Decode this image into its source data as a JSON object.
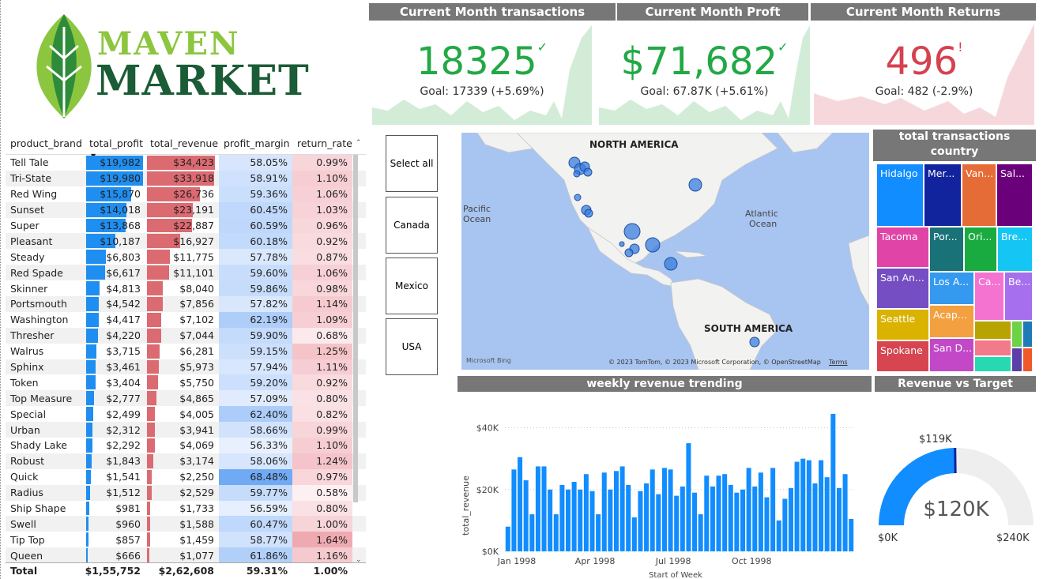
{
  "logo": {
    "line1": "MAVEN",
    "line2": "MARKET"
  },
  "table": {
    "headers": [
      "product_brand",
      "total_profit",
      "total_revenue",
      "profit_margin",
      "return_rate"
    ],
    "rows": [
      [
        "Tell Tale",
        "$19,982",
        "$34,423",
        "58.05%",
        "0.99%"
      ],
      [
        "Tri-State",
        "$19,980",
        "$33,918",
        "58.91%",
        "1.10%"
      ],
      [
        "Red Wing",
        "$15,870",
        "$26,736",
        "59.36%",
        "1.06%"
      ],
      [
        "Sunset",
        "$14,018",
        "$23,191",
        "60.45%",
        "1.03%"
      ],
      [
        "Super",
        "$13,868",
        "$22,887",
        "60.59%",
        "0.96%"
      ],
      [
        "Pleasant",
        "$10,187",
        "$16,927",
        "60.18%",
        "0.92%"
      ],
      [
        "Steady",
        "$6,803",
        "$11,775",
        "57.78%",
        "0.87%"
      ],
      [
        "Red Spade",
        "$6,617",
        "$11,101",
        "59.60%",
        "1.06%"
      ],
      [
        "Skinner",
        "$4,813",
        "$8,040",
        "59.86%",
        "0.98%"
      ],
      [
        "Portsmouth",
        "$4,542",
        "$7,856",
        "57.82%",
        "1.14%"
      ],
      [
        "Washington",
        "$4,417",
        "$7,102",
        "62.19%",
        "1.09%"
      ],
      [
        "Thresher",
        "$4,220",
        "$7,044",
        "59.90%",
        "0.68%"
      ],
      [
        "Walrus",
        "$3,715",
        "$6,281",
        "59.15%",
        "1.25%"
      ],
      [
        "Sphinx",
        "$3,461",
        "$5,973",
        "57.94%",
        "1.11%"
      ],
      [
        "Token",
        "$3,404",
        "$5,750",
        "59.20%",
        "0.92%"
      ],
      [
        "Top Measure",
        "$2,777",
        "$4,865",
        "57.09%",
        "0.80%"
      ],
      [
        "Special",
        "$2,499",
        "$4,005",
        "62.40%",
        "0.82%"
      ],
      [
        "Urban",
        "$2,312",
        "$3,941",
        "58.66%",
        "0.99%"
      ],
      [
        "Shady Lake",
        "$2,292",
        "$4,069",
        "56.33%",
        "1.10%"
      ],
      [
        "Robust",
        "$1,843",
        "$3,174",
        "58.06%",
        "1.24%"
      ],
      [
        "Quick",
        "$1,541",
        "$2,250",
        "68.48%",
        "0.97%"
      ],
      [
        "Radius",
        "$1,512",
        "$2,529",
        "59.77%",
        "0.58%"
      ],
      [
        "Ship Shape",
        "$981",
        "$1,733",
        "56.59%",
        "0.80%"
      ],
      [
        "Swell",
        "$960",
        "$1,588",
        "60.47%",
        "1.00%"
      ],
      [
        "Tip Top",
        "$857",
        "$1,459",
        "58.77%",
        "1.64%"
      ],
      [
        "Queen",
        "$666",
        "$1,077",
        "61.86%",
        "1.16%"
      ]
    ],
    "total": [
      "Total",
      "$1,55,752",
      "$2,62,608",
      "59.31%",
      "1.00%"
    ]
  },
  "kpis": {
    "transactions": {
      "title": "Current Month transactions",
      "value": "18325",
      "mark": "✓",
      "goal": "Goal: 17339 (+5.69%)",
      "color": "#22a845"
    },
    "profit": {
      "title": "Current Month Proft",
      "value": "$71,682",
      "mark": "✓",
      "goal": "Goal: 67.87K (+5.61%)",
      "color": "#22a845"
    },
    "returns": {
      "title": "Current Month Returns",
      "value": "496",
      "mark": "!",
      "goal": "Goal: 482 (-2.9%)",
      "color": "#d6404f"
    }
  },
  "slicer": {
    "items": [
      "Select all",
      "Canada",
      "Mexico",
      "USA"
    ]
  },
  "map": {
    "labels": {
      "north_america": "NORTH AMERICA",
      "south_america": "SOUTH AMERICA",
      "pacific1": "Pacific",
      "pacific2": "Ocean",
      "atlantic1": "Atlantic",
      "atlantic2": "Ocean"
    },
    "bing": "Microsoft Bing",
    "credits": "© 2023 TomTom, © 2023 Microsoft Corporation, © OpenStreetMap",
    "terms": "Terms"
  },
  "treemap": {
    "title": "total transactions country",
    "tiles": [
      "Hidalgo",
      "Mer...",
      "Van...",
      "Sal...",
      "Tacoma",
      "Por...",
      "Ori...",
      "Bre...",
      "San An...",
      "Los A...",
      "Ca...",
      "Be...",
      "Seattle",
      "Acap...",
      "Spokane",
      "San D..."
    ]
  },
  "weekly": {
    "title": "weekly revenue trending",
    "ylabel": "total_revenue",
    "xlabel": "Start of Week",
    "yticks": [
      "$0K",
      "$20K",
      "$40K"
    ],
    "xticks": [
      "Jan 1998",
      "Apr 1998",
      "Jul 1998",
      "Oct 1998"
    ]
  },
  "gauge": {
    "title": "Revenue vs Target",
    "value_label": "$120K",
    "target_label": "$119K",
    "min_label": "$0K",
    "max_label": "$240K",
    "value": 120,
    "target": 119,
    "max": 240
  },
  "chart_data": {
    "type": "bar",
    "title": "weekly revenue trending",
    "xlabel": "Start of Week",
    "ylabel": "total_revenue",
    "ylim": [
      0,
      45000
    ],
    "categories_ticks": [
      "Jan 1998",
      "Apr 1998",
      "Jul 1998",
      "Oct 1998"
    ],
    "values": [
      8000,
      26500,
      30500,
      23000,
      12000,
      27500,
      27500,
      20000,
      12000,
      21500,
      20000,
      22500,
      20000,
      25000,
      19500,
      12000,
      25500,
      20000,
      26000,
      27500,
      21500,
      11000,
      19500,
      22000,
      26500,
      18500,
      27000,
      26500,
      18000,
      21000,
      35000,
      19000,
      12000,
      24500,
      21000,
      24500,
      25000,
      21500,
      19000,
      20000,
      27000,
      21000,
      25500,
      17500,
      27000,
      10000,
      17000,
      20500,
      29000,
      30000,
      29500,
      22000,
      29500,
      24000,
      44500,
      20500,
      25000,
      10500
    ]
  }
}
